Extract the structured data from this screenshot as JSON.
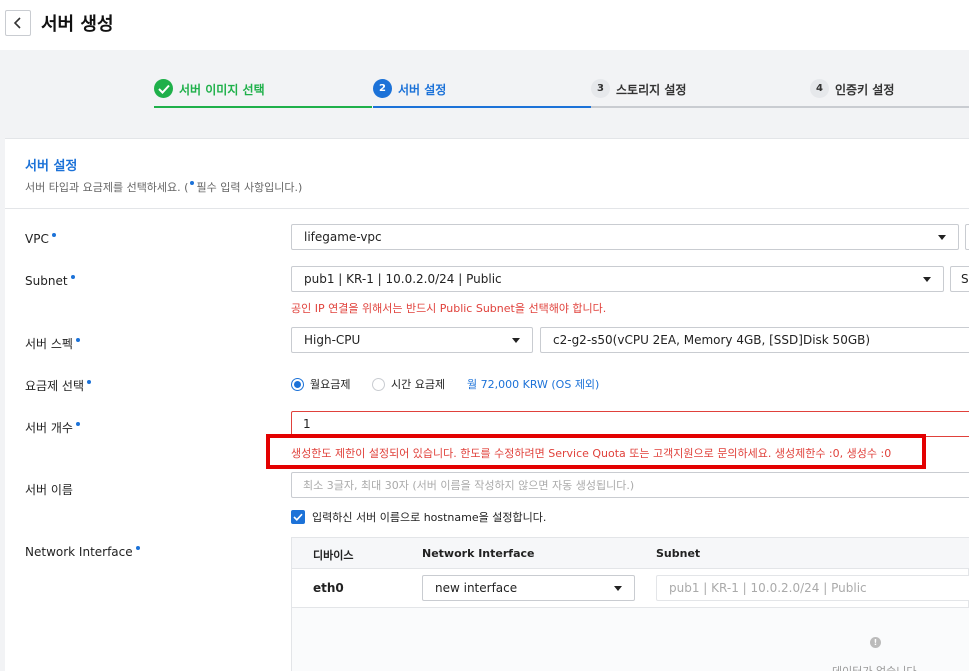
{
  "page": {
    "title": "서버 생성"
  },
  "steps": [
    {
      "num": "",
      "label": "서버 이미지 선택",
      "state": "done"
    },
    {
      "num": "2",
      "label": "서버 설정",
      "state": "active"
    },
    {
      "num": "3",
      "label": "스토리지 설정",
      "state": "todo"
    },
    {
      "num": "4",
      "label": "인증키 설정",
      "state": "todo"
    }
  ],
  "section": {
    "title": "서버 설정",
    "desc_before": "서버 타입과 요금제를 선택하세요. (",
    "desc_after": "필수 입력 사항입니다.)"
  },
  "fields": {
    "vpc": {
      "label": "VPC",
      "value": "lifegame-vpc"
    },
    "subnet": {
      "label": "Subnet",
      "value": "pub1 | KR-1 | 10.0.2.0/24 | Public",
      "side_text": "S",
      "warning": "공인 IP 연결을 위해서는 반드시 Public Subnet을 선택해야 합니다."
    },
    "spec": {
      "label": "서버 스펙",
      "type_value": "High-CPU",
      "spec_value": "c2-g2-s50(vCPU 2EA, Memory 4GB, [SSD]Disk 50GB)"
    },
    "billing": {
      "label": "요금제 선택",
      "option_monthly": "월요금제",
      "option_hourly": "시간 요금제",
      "price": "월 72,000 KRW (OS 제외)"
    },
    "count": {
      "label": "서버 개수",
      "value": "1",
      "error": "생성한도 제한이 설정되어 있습니다. 한도를 수정하려면 Service Quota 또는 고객지원으로 문의하세요. 생성제한수 :0, 생성수 :0"
    },
    "name": {
      "label": "서버 이름",
      "placeholder": "최소 3글자, 최대 30자 (서버 이름을 작성하지 않으면 자동 생성됩니다.)",
      "checkbox_label": "입력하신 서버 이름으로 hostname을 설정합니다."
    },
    "network": {
      "label": "Network Interface",
      "col_device": "디바이스",
      "col_interface": "Network Interface",
      "col_subnet": "Subnet",
      "device": "eth0",
      "interface_value": "new interface",
      "subnet_value": "pub1 | KR-1 | 10.0.2.0/24 | Public",
      "empty_text": "데이터가 없습니다."
    }
  },
  "colors": {
    "primary": "#1c72d8",
    "success": "#1fb04a",
    "error": "#e0413b",
    "highlight": "#e30000"
  }
}
